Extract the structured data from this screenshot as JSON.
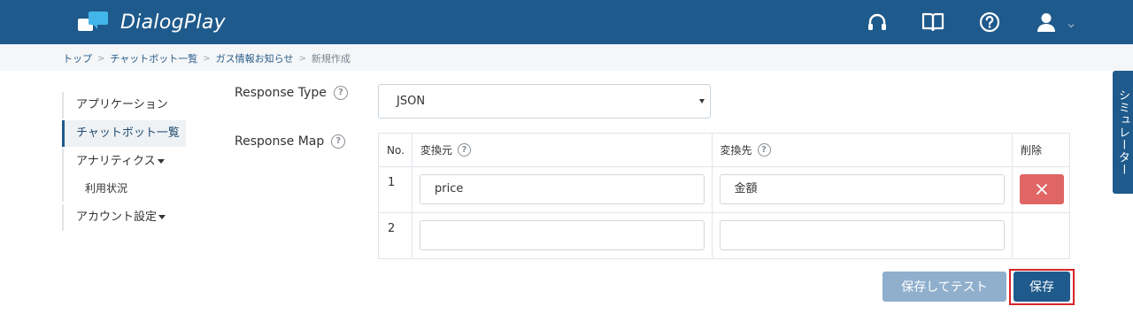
{
  "header": {
    "app_name": "DialogPlay",
    "icons": [
      "headset-icon",
      "book-icon",
      "help-circle-icon",
      "user-icon",
      "chevron-down-icon"
    ],
    "colors": {
      "background": "#1f5a8c",
      "logo_accent": "#42b6ea"
    }
  },
  "breadcrumb": {
    "items": [
      "トップ",
      "チャットボット一覧",
      "ガス情報お知らせ"
    ],
    "current": "新規作成",
    "separator": ">"
  },
  "sidebar": {
    "items": [
      {
        "label": "アプリケーション"
      },
      {
        "label": "チャットボット一覧",
        "active": true
      },
      {
        "label": "アナリティクス"
      },
      {
        "label": "利用状況"
      },
      {
        "label": "アカウント設定"
      }
    ]
  },
  "form": {
    "response_type_label": "Response Type",
    "response_type_value": "JSON",
    "response_map_label": "Response Map",
    "help_symbol": "?",
    "table": {
      "headers": {
        "no": "No.",
        "source": "変換元",
        "target": "変換先",
        "delete": "削除"
      },
      "rows": [
        {
          "no": "1",
          "source": "price",
          "target": "金額"
        },
        {
          "no": "2",
          "source": "",
          "target": ""
        }
      ]
    }
  },
  "actions": {
    "save_and_test_label": "保存してテスト",
    "save_label": "保存",
    "colors": {
      "save_and_test": "#8fafcd",
      "save": "#1f5a8c",
      "delete": "#e06666",
      "highlight": "#d9232a"
    }
  },
  "simulator_tab": {
    "label": "シミュレーター"
  }
}
